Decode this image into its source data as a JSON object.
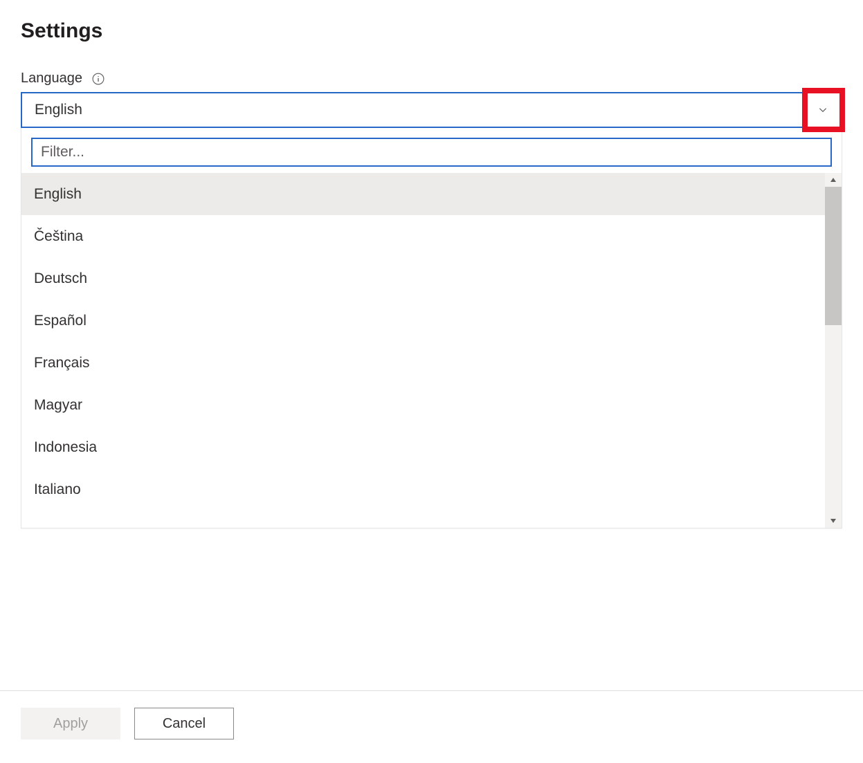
{
  "page": {
    "title": "Settings"
  },
  "language": {
    "label": "Language",
    "selected": "English",
    "filter_placeholder": "Filter...",
    "options": [
      "English",
      "Čeština",
      "Deutsch",
      "Español",
      "Français",
      "Magyar",
      "Indonesia",
      "Italiano"
    ]
  },
  "footer": {
    "apply_label": "Apply",
    "cancel_label": "Cancel"
  },
  "colors": {
    "accent": "#2666c4",
    "highlight": "#e81123"
  }
}
